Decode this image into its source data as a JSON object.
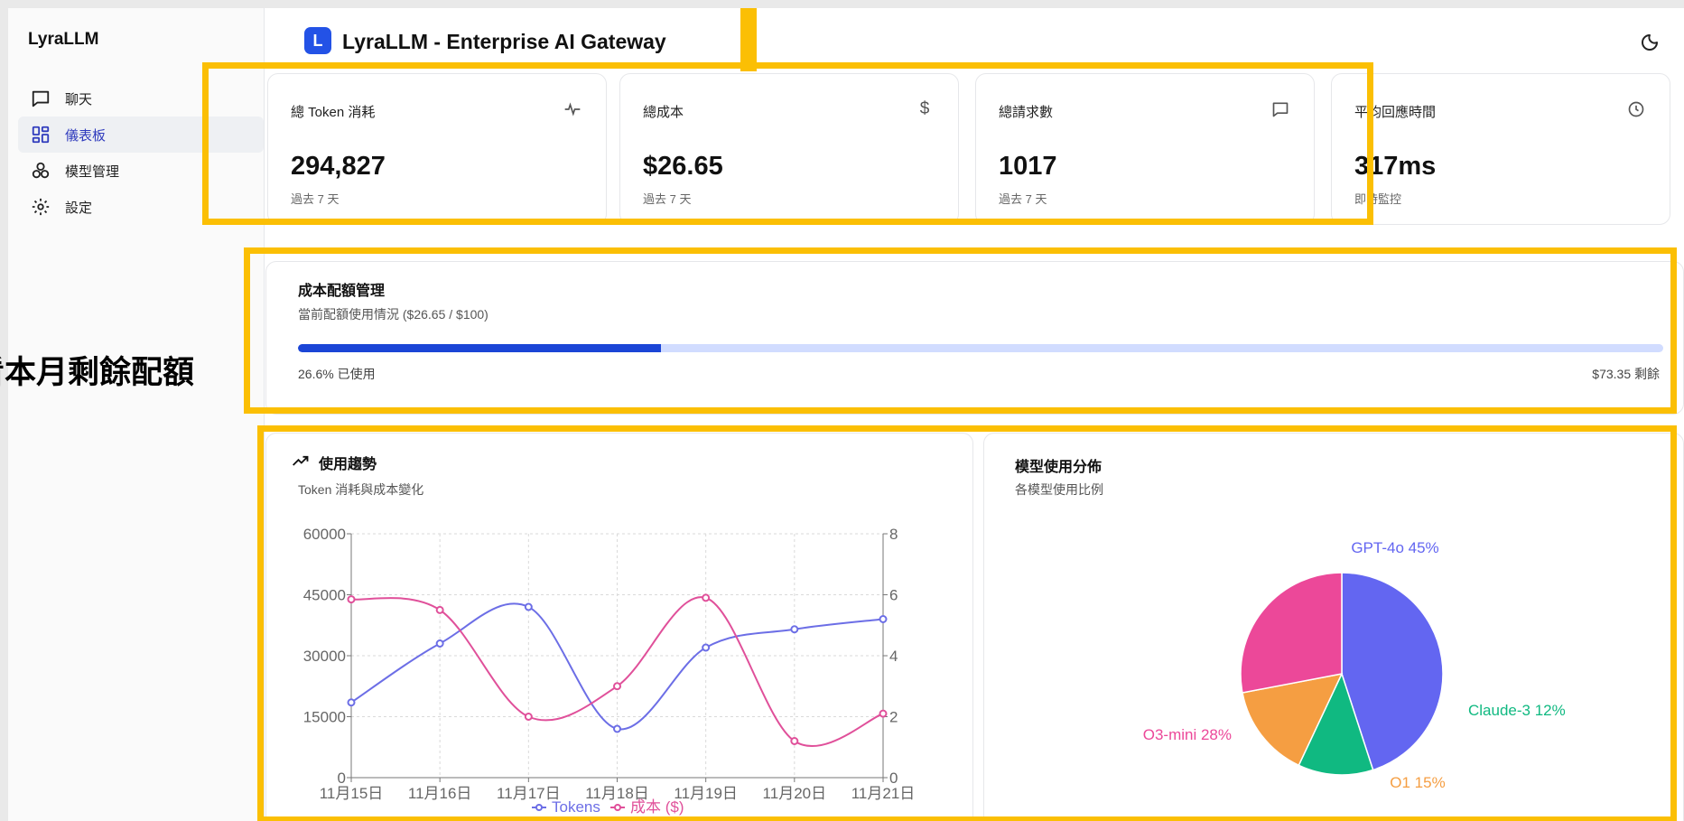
{
  "sidebar": {
    "brand": "LyraLLM",
    "items": [
      {
        "label": "聊天",
        "icon": "chat-icon"
      },
      {
        "label": "儀表板",
        "icon": "dashboard-icon"
      },
      {
        "label": "模型管理",
        "icon": "models-icon"
      },
      {
        "label": "設定",
        "icon": "gear-icon"
      }
    ]
  },
  "header": {
    "logo_letter": "L",
    "title": "LyraLLM - Enterprise AI Gateway",
    "theme_icon": "moon-icon"
  },
  "stats": [
    {
      "label": "總 Token 消耗",
      "value": "294,827",
      "sub": "過去 7 天",
      "icon": "activity-icon"
    },
    {
      "label": "總成本",
      "value": "$26.65",
      "sub": "過去 7 天",
      "icon": "dollar-icon"
    },
    {
      "label": "總請求數",
      "value": "1017",
      "sub": "過去 7 天",
      "icon": "message-icon"
    },
    {
      "label": "平均回應時間",
      "value": "317ms",
      "sub": "即時監控",
      "icon": "clock-icon"
    }
  ],
  "quota": {
    "title": "成本配額管理",
    "subtitle": "當前配額使用情況 ($26.65 / $100)",
    "used_label": "26.6% 已使用",
    "remaining_label": "$73.35 剩餘",
    "used_fraction": 0.266
  },
  "annotation": {
    "text": "看本月剩餘配額"
  },
  "trend": {
    "title": "使用趨勢",
    "subtitle": "Token 消耗與成本變化",
    "icon": "trending-up-icon"
  },
  "pie": {
    "title": "模型使用分佈",
    "subtitle": "各模型使用比例"
  },
  "colors": {
    "tokens": "#6c6ee6",
    "cost": "#e0509a",
    "accent": "#1b45d6",
    "highlight": "#fbbf04"
  },
  "chart_data": [
    {
      "type": "line",
      "categories": [
        "11月15日",
        "11月16日",
        "11月17日",
        "11月18日",
        "11月19日",
        "11月20日",
        "11月21日"
      ],
      "series": [
        {
          "name": "Tokens",
          "axis": "left",
          "values": [
            18500,
            33000,
            42000,
            12000,
            32000,
            36500,
            39000
          ]
        },
        {
          "name": "成本 ($)",
          "axis": "right",
          "values": [
            5.85,
            5.5,
            2.0,
            3.0,
            5.9,
            1.2,
            2.1
          ]
        }
      ],
      "y_left": {
        "min": 0,
        "max": 60000,
        "ticks": [
          0,
          15000,
          30000,
          45000,
          60000
        ]
      },
      "y_right": {
        "min": 0,
        "max": 8,
        "ticks": [
          0,
          2,
          4,
          6,
          8
        ]
      },
      "grid": true,
      "legend": "bottom"
    },
    {
      "type": "pie",
      "slices": [
        {
          "label": "GPT-4o 45%",
          "value": 45,
          "color": "#6366f1"
        },
        {
          "label": "Claude-3 12%",
          "value": 12,
          "color": "#10b981"
        },
        {
          "label": "O1 15%",
          "value": 15,
          "color": "#f59e42"
        },
        {
          "label": "O3-mini 28%",
          "value": 28,
          "color": "#ec4899"
        }
      ]
    }
  ]
}
